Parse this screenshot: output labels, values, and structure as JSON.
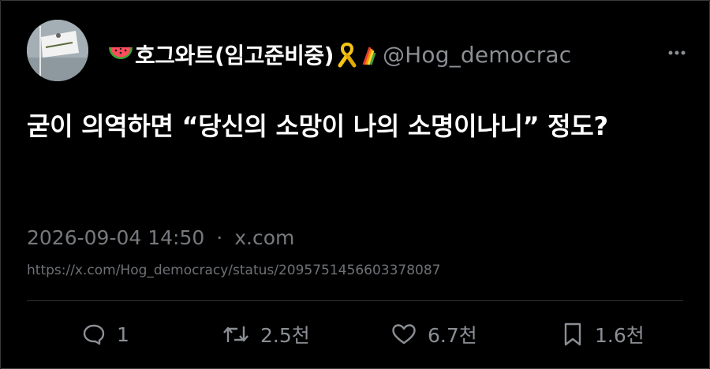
{
  "author": {
    "display_name": "호그와트(임고준비중)",
    "handle": "@Hog_democrac",
    "avatar_icon": "flag-photo-avatar",
    "name_prefix_icon": "watermelon-emoji",
    "name_suffix_icons": [
      "yellow-ribbon-emoji",
      "rainbow-flag-emoji"
    ]
  },
  "tweet": {
    "text": "굳이 의역하면 “당신의 소망이 나의 소명이나니” 정도?"
  },
  "meta": {
    "timestamp": "2026-09-04 14:50",
    "separator": "·",
    "source": "x.com"
  },
  "url": "https://x.com/Hog_democracy/status/2095751456603378087",
  "actions": {
    "reply": {
      "icon": "reply-bubble-icon",
      "count": "1"
    },
    "repost": {
      "icon": "repost-icon",
      "count": "2.5천"
    },
    "like": {
      "icon": "heart-icon",
      "count": "6.7천"
    },
    "bookmark": {
      "icon": "bookmark-icon",
      "count": "1.6천"
    }
  },
  "more_icon": "more-dots-icon",
  "colors": {
    "background": "#000000",
    "primary_text": "#ffffff",
    "secondary_text": "#8b8f94",
    "divider": "#2f3336"
  }
}
